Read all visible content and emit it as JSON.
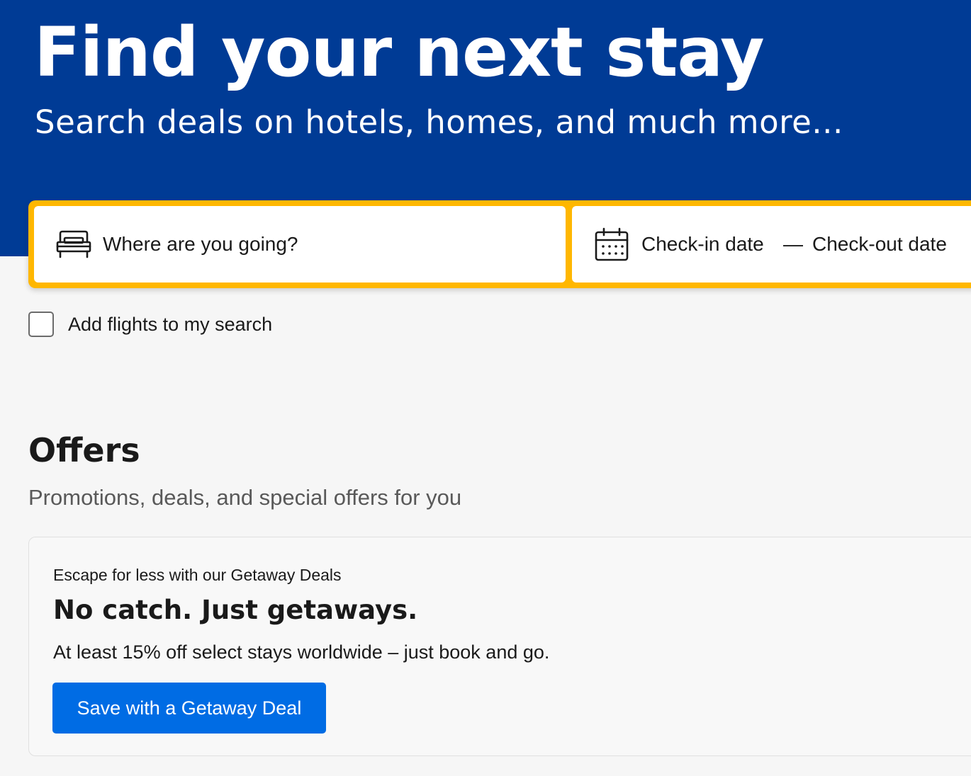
{
  "hero": {
    "title": "Find your next stay",
    "subtitle": "Search deals on hotels, homes, and much more...",
    "background_color": "#003b95"
  },
  "search": {
    "destination_placeholder": "Where are you going?",
    "destination_value": "",
    "destination_icon": "bed-icon",
    "dates_icon": "calendar-icon",
    "checkin_label": "Check-in date",
    "dash": "—",
    "checkout_label": "Check-out date",
    "border_color": "#ffb700"
  },
  "flights": {
    "label": "Add flights to my search",
    "checked": false
  },
  "offers": {
    "title": "Offers",
    "subtitle": "Promotions, deals, and special offers for you",
    "card": {
      "eyebrow": "Escape for less with our Getaway Deals",
      "heading": "No catch. Just getaways.",
      "body": "At least 15% off select stays worldwide – just book and go.",
      "button_label": "Save with a Getaway Deal",
      "button_color": "#006ce4"
    }
  }
}
